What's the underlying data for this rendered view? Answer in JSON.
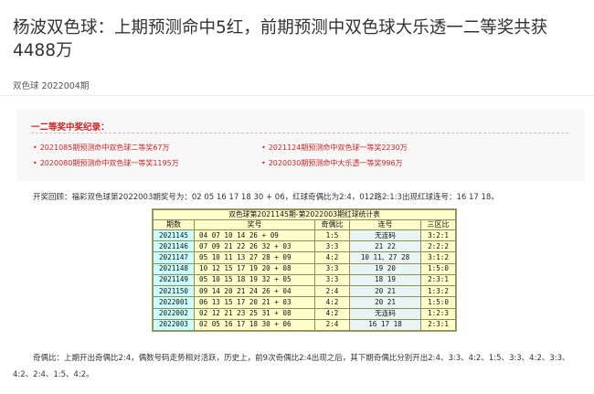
{
  "article": {
    "title": "杨波双色球：上期预测命中5红，前期预测中双色球大乐透一二等奖共获4488万",
    "meta": "双色球 2022004期"
  },
  "awards": {
    "heading": "一二等奖中奖纪录：",
    "items": [
      "2021085期预测命中双色球二等奖67万",
      "2021124期预测命中双色球一等奖2230万",
      "2020080期预测命中双色球一等奖1195万",
      "2020030期预测命中大乐透一等奖996万"
    ]
  },
  "open_result": "开奖回顾：福彩双色球第2022003期奖号为：02 05 16 17 18 30 + 06，红球奇偶比为2:4，012路2:1:3出现红球连号：16 17 18。",
  "stats_table": {
    "caption": "双色球第2021145期-第2022003期红球统计表",
    "headers": [
      "期数",
      "奖号",
      "奇偶比",
      "连号",
      "三区比"
    ],
    "rows": [
      [
        "2021145",
        "04 07 10 14 26 + 09",
        "1:5",
        "无连码",
        "3:2:1"
      ],
      [
        "2021146",
        "07 09 21 22 26 32 + 03",
        "3:3",
        "21 22",
        "2:2:2"
      ],
      [
        "2021147",
        "05 10 11 13 27 28 + 09",
        "4:2",
        "10 11、27 28",
        "3:1:2"
      ],
      [
        "2021148",
        "10 12 15 17 19 20 + 08",
        "3:3",
        "19 20",
        "1:5:0"
      ],
      [
        "2021149",
        "05 10 15 18 19 32 + 05",
        "3:3",
        "18 19",
        "2:3:1"
      ],
      [
        "2021150",
        "09 14 20 21 24 26 + 04",
        "2:4",
        "20 21",
        "1:3:2"
      ],
      [
        "2022001",
        "06 13 15 17 20 21 + 03",
        "4:2",
        "20 21",
        "1:5:0"
      ],
      [
        "2022002",
        "02 12 21 23 25 31 + 08",
        "4:2",
        "无连码",
        "1:2:3"
      ],
      [
        "2022003",
        "02 05 16 17 18 30 + 06",
        "2:4",
        "16 17 18",
        "2:3:1"
      ]
    ]
  },
  "analysis": "奇偶比：上期开出奇偶比2:4，偶数号码走势相对活跃，历史上，前9次奇偶比2:4出现之后，其下期奇偶比分别开出2:4、3:3、4:2、1:5、3:3、4:2、3:3、4:2、2:4、1:5、4:2。"
}
